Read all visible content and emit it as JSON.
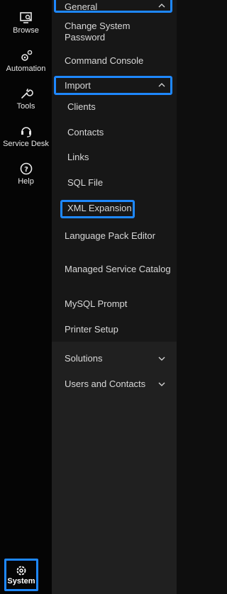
{
  "rail": {
    "browse": "Browse",
    "automation": "Automation",
    "tools": "Tools",
    "service_desk": "Service Desk",
    "help": "Help",
    "system": "System"
  },
  "menu": {
    "general": "General",
    "general_items": [
      "Change System Password",
      "Command Console"
    ],
    "import": "Import",
    "import_items": [
      "Clients",
      "Contacts",
      "Links",
      "SQL File",
      "XML Expansion"
    ],
    "other_items": [
      "Language Pack Editor",
      "Managed Service Catalog",
      "MySQL Prompt",
      "Printer Setup"
    ],
    "solutions": "Solutions",
    "users_and_contacts": "Users and Contacts"
  },
  "colors": {
    "highlight": "#1e88ff",
    "text": "#d9d9d9"
  }
}
